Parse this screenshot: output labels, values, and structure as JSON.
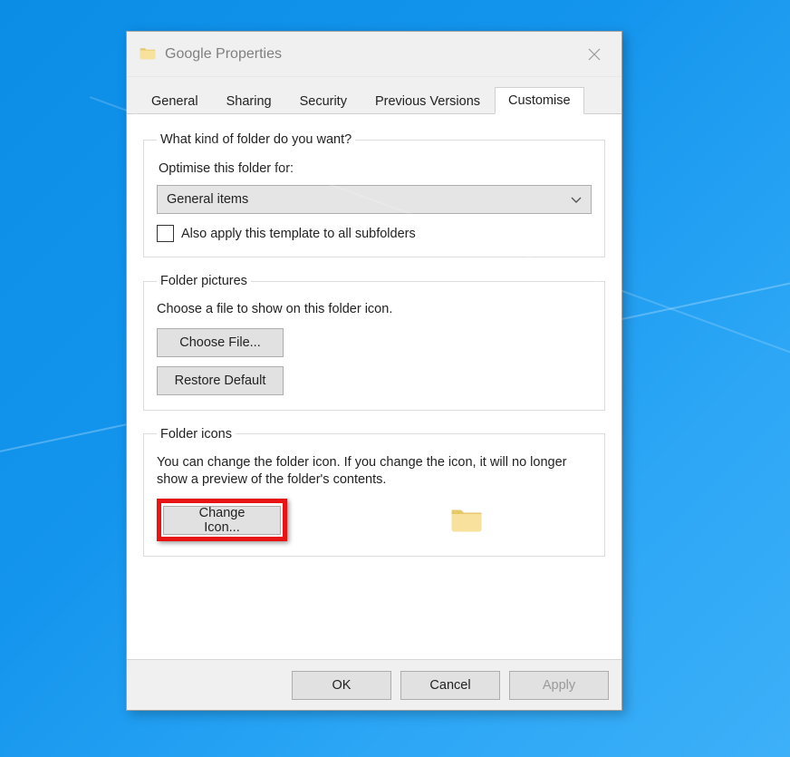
{
  "titlebar": {
    "title": "Google Properties"
  },
  "tabs": [
    {
      "label": "General"
    },
    {
      "label": "Sharing"
    },
    {
      "label": "Security"
    },
    {
      "label": "Previous Versions"
    },
    {
      "label": "Customise",
      "active": true
    }
  ],
  "section1": {
    "legend": "What kind of folder do you want?",
    "optimise_label": "Optimise this folder for:",
    "selected_option": "General items",
    "checkbox_label": "Also apply this template to all subfolders"
  },
  "section2": {
    "legend": "Folder pictures",
    "desc": "Choose a file to show on this folder icon.",
    "choose_file": "Choose File...",
    "restore_default": "Restore Default"
  },
  "section3": {
    "legend": "Folder icons",
    "desc": "You can change the folder icon. If you change the icon, it will no longer show a preview of the folder's contents.",
    "change_icon": "Change Icon..."
  },
  "footer": {
    "ok": "OK",
    "cancel": "Cancel",
    "apply": "Apply"
  }
}
